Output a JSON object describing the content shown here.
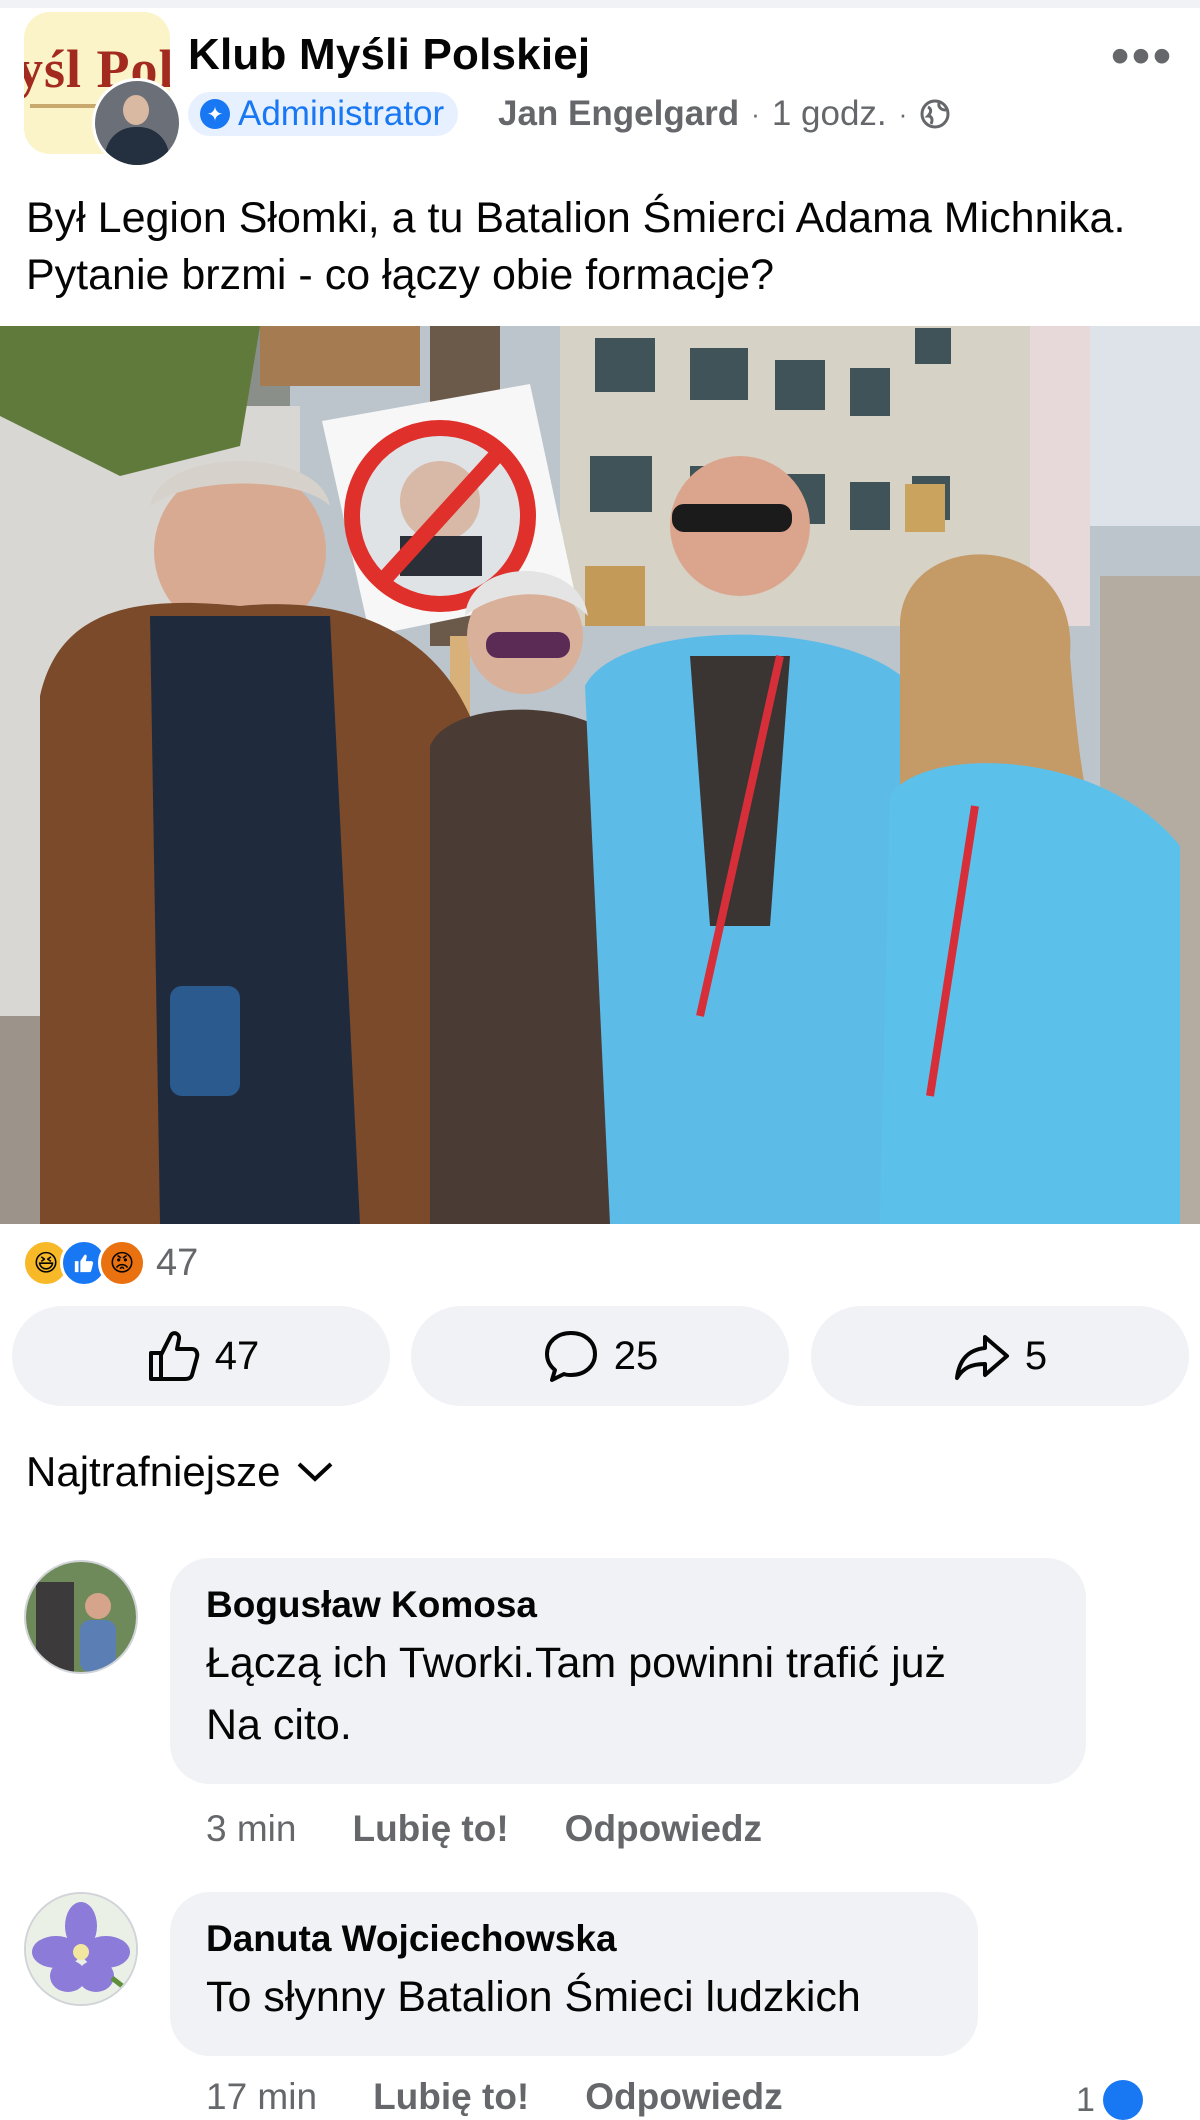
{
  "post": {
    "page_name": "Klub Myśli Polskiej",
    "page_logo_text": "yśl Pols",
    "badge": "Administrator",
    "author": "Jan Engelgard",
    "time": "1 godz.",
    "separator": "·",
    "text": "Był Legion Słomki, a tu Batalion Śmierci Adama Michnika. Pytanie brzmi - co łączy obie formacje?",
    "icons": [
      "more-icon",
      "admin-star-icon",
      "globe-icon"
    ]
  },
  "reactions": {
    "types": [
      "haha",
      "like",
      "angry"
    ],
    "total": "47"
  },
  "actions": {
    "like_count": "47",
    "comment_count": "25",
    "share_count": "5"
  },
  "sort": {
    "label": "Najtrafniejsze"
  },
  "comments": [
    {
      "author": "Bogusław Komosa",
      "text_line1": "Łączą ich Tworki.Tam powinni trafić już",
      "text_line2": "Na cito.",
      "time": "3 min",
      "like_label": "Lubię to!",
      "reply_label": "Odpowiedz"
    },
    {
      "author": "Danuta Wojciechowska",
      "text": "To słynny Batalion Śmieci ludzkich",
      "time": "17 min",
      "like_label": "Lubię to!",
      "reply_label": "Odpowiedz",
      "likes": "1"
    }
  ],
  "colors": {
    "accent": "#1877f2",
    "secondary_text": "#65676b",
    "surface": "#f0f2f5"
  }
}
